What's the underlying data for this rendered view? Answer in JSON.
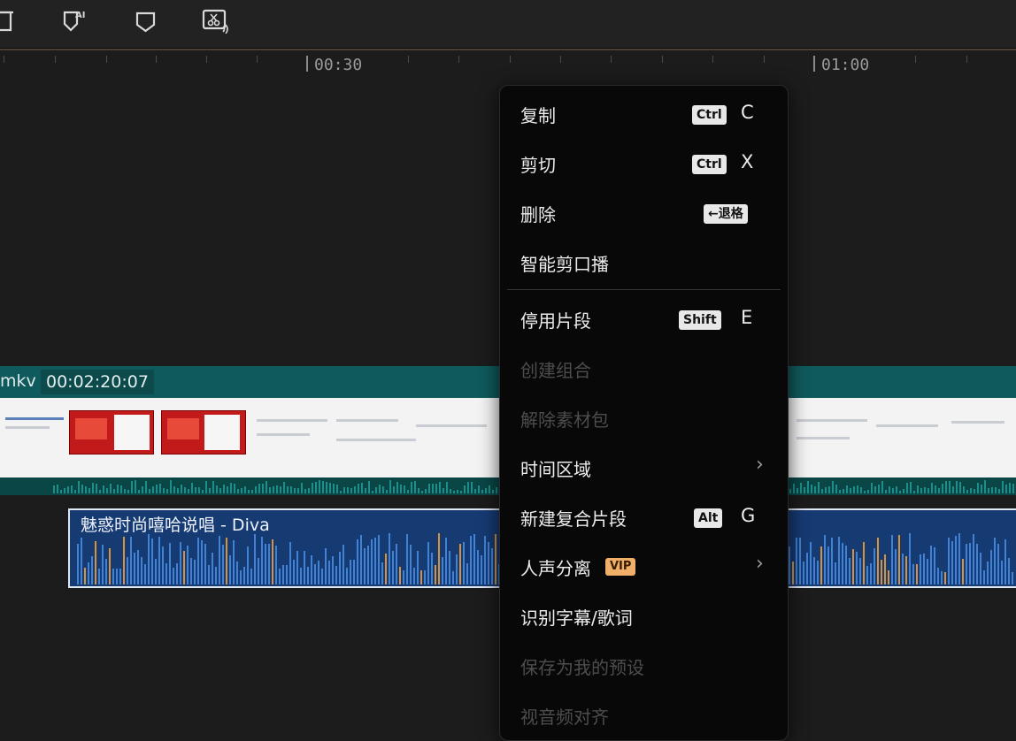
{
  "toolbar": {
    "icons": [
      "delete-icon",
      "ai-marker-icon",
      "marker-icon",
      "smart-cut-icon"
    ],
    "ai_badge": "AI"
  },
  "ruler": {
    "labels": [
      "00:30",
      "01:00"
    ]
  },
  "video_clip": {
    "name": "mkv",
    "duration": "00:02:20:07"
  },
  "audio_clip": {
    "title": "魅惑时尚嘻哈说唱 - Diva"
  },
  "context_menu": {
    "items": [
      {
        "label": "复制",
        "modifier": "Ctrl",
        "key": "C",
        "enabled": true
      },
      {
        "label": "剪切",
        "modifier": "Ctrl",
        "key": "X",
        "enabled": true
      },
      {
        "label": "删除",
        "modifier": "←退格",
        "key": "",
        "enabled": true
      },
      {
        "label": "智能剪口播",
        "modifier": "",
        "key": "",
        "enabled": true
      },
      {
        "label": "停用片段",
        "modifier": "Shift",
        "key": "E",
        "enabled": true
      },
      {
        "label": "创建组合",
        "modifier": "",
        "key": "",
        "enabled": false
      },
      {
        "label": "解除素材包",
        "modifier": "",
        "key": "",
        "enabled": false
      },
      {
        "label": "时间区域",
        "modifier": "",
        "key": "",
        "submenu": true,
        "enabled": true
      },
      {
        "label": "新建复合片段",
        "modifier": "Alt",
        "key": "G",
        "enabled": true
      },
      {
        "label": "人声分离",
        "badge": "VIP",
        "submenu": true,
        "enabled": true
      },
      {
        "label": "识别字幕/歌词",
        "modifier": "",
        "key": "",
        "enabled": true
      },
      {
        "label": "保存为我的预设",
        "modifier": "",
        "key": "",
        "enabled": false
      },
      {
        "label": "视音频对齐",
        "modifier": "",
        "key": "",
        "enabled": false
      }
    ],
    "chevron": "›"
  },
  "colors": {
    "background": "#1c1c1d",
    "menu_bg": "#080808",
    "video_track": "#0f5a5c",
    "audio_track": "#163a72",
    "vip_badge": "#f0b06a"
  }
}
